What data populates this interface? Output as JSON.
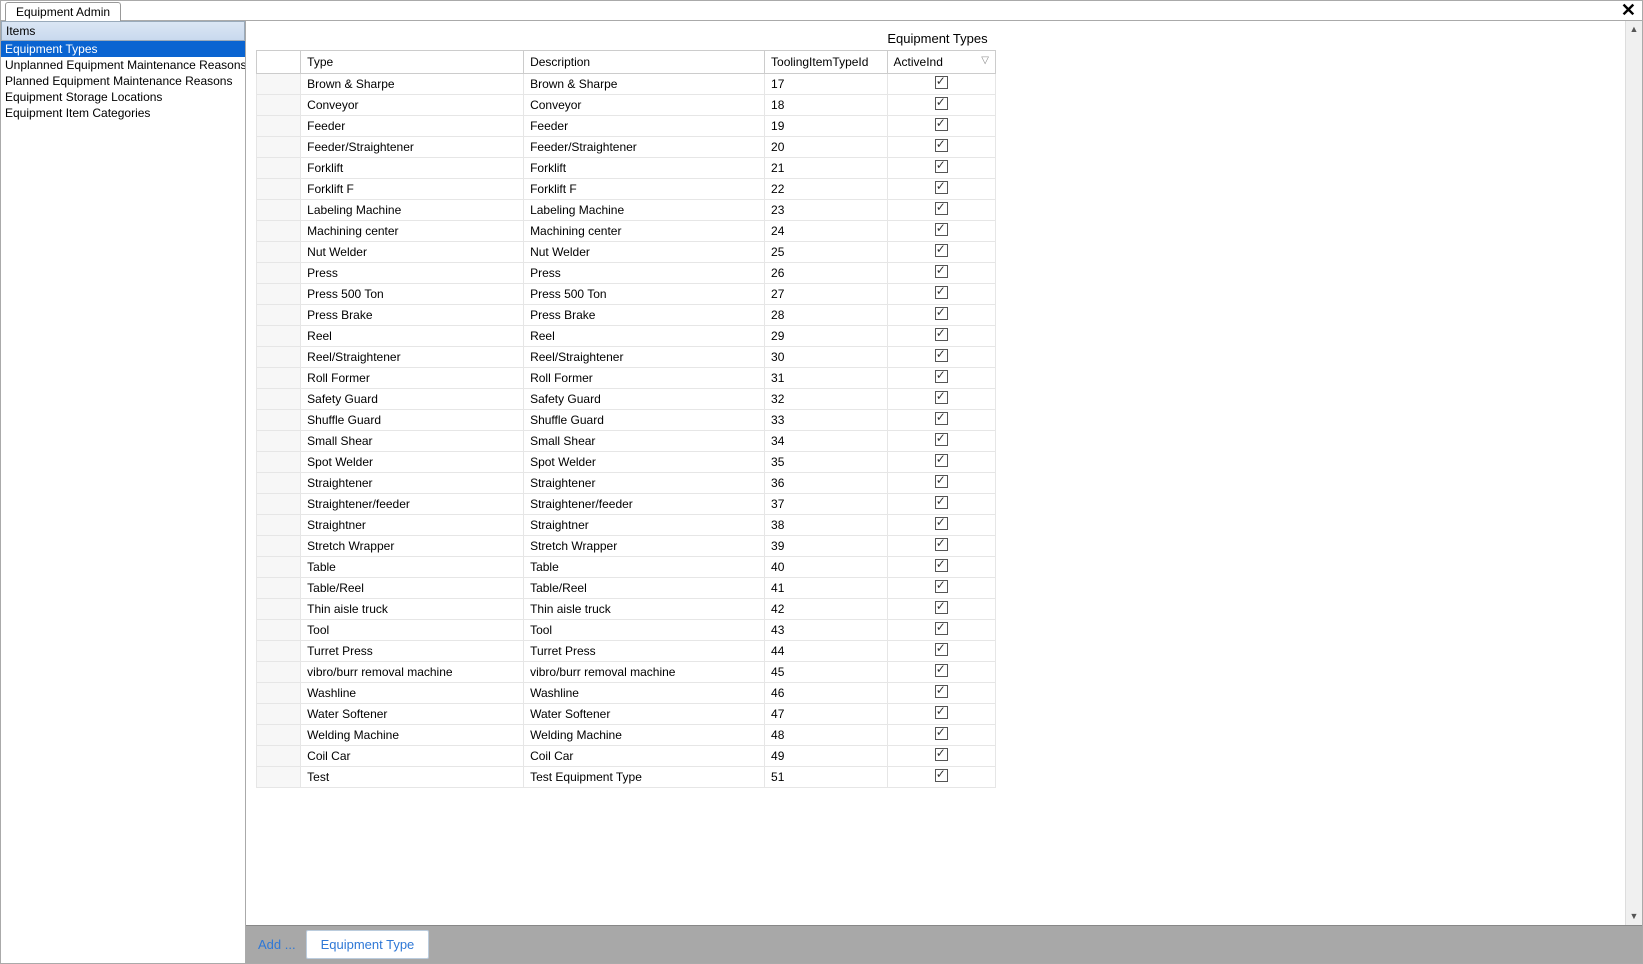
{
  "tab": {
    "label": "Equipment Admin"
  },
  "sidebar": {
    "header": "Items",
    "items": [
      {
        "label": "Equipment Types",
        "selected": true
      },
      {
        "label": "Unplanned Equipment Maintenance Reasons",
        "selected": false
      },
      {
        "label": "Planned Equipment Maintenance Reasons",
        "selected": false
      },
      {
        "label": "Equipment Storage Locations",
        "selected": false
      },
      {
        "label": "Equipment Item Categories",
        "selected": false
      }
    ]
  },
  "grid": {
    "title": "Equipment Types",
    "columns": {
      "type": "Type",
      "description": "Description",
      "toolingItemTypeId": "ToolingItemTypeId",
      "activeInd": "ActiveInd"
    },
    "rows": [
      {
        "type": "Brown & Sharpe",
        "description": "Brown & Sharpe",
        "id": "17",
        "active": true
      },
      {
        "type": "Conveyor",
        "description": "Conveyor",
        "id": "18",
        "active": true
      },
      {
        "type": "Feeder",
        "description": "Feeder",
        "id": "19",
        "active": true
      },
      {
        "type": "Feeder/Straightener",
        "description": "Feeder/Straightener",
        "id": "20",
        "active": true
      },
      {
        "type": "Forklift",
        "description": "Forklift",
        "id": "21",
        "active": true
      },
      {
        "type": "Forklift F",
        "description": "Forklift F",
        "id": "22",
        "active": true
      },
      {
        "type": "Labeling Machine",
        "description": "Labeling Machine",
        "id": "23",
        "active": true
      },
      {
        "type": "Machining center",
        "description": "Machining center",
        "id": "24",
        "active": true
      },
      {
        "type": "Nut Welder",
        "description": "Nut Welder",
        "id": "25",
        "active": true
      },
      {
        "type": "Press",
        "description": "Press",
        "id": "26",
        "active": true
      },
      {
        "type": "Press 500 Ton",
        "description": "Press 500 Ton",
        "id": "27",
        "active": true
      },
      {
        "type": "Press Brake",
        "description": "Press Brake",
        "id": "28",
        "active": true
      },
      {
        "type": "Reel",
        "description": "Reel",
        "id": "29",
        "active": true
      },
      {
        "type": "Reel/Straightener",
        "description": "Reel/Straightener",
        "id": "30",
        "active": true
      },
      {
        "type": "Roll Former",
        "description": "Roll Former",
        "id": "31",
        "active": true
      },
      {
        "type": "Safety Guard",
        "description": "Safety Guard",
        "id": "32",
        "active": true
      },
      {
        "type": "Shuffle Guard",
        "description": "Shuffle Guard",
        "id": "33",
        "active": true
      },
      {
        "type": "Small Shear",
        "description": "Small Shear",
        "id": "34",
        "active": true
      },
      {
        "type": "Spot Welder",
        "description": "Spot Welder",
        "id": "35",
        "active": true
      },
      {
        "type": "Straightener",
        "description": "Straightener",
        "id": "36",
        "active": true
      },
      {
        "type": "Straightener/feeder",
        "description": "Straightener/feeder",
        "id": "37",
        "active": true
      },
      {
        "type": "Straightner",
        "description": "Straightner",
        "id": "38",
        "active": true
      },
      {
        "type": "Stretch Wrapper",
        "description": "Stretch Wrapper",
        "id": "39",
        "active": true
      },
      {
        "type": "Table",
        "description": "Table",
        "id": "40",
        "active": true
      },
      {
        "type": "Table/Reel",
        "description": "Table/Reel",
        "id": "41",
        "active": true
      },
      {
        "type": "Thin aisle truck",
        "description": "Thin aisle truck",
        "id": "42",
        "active": true
      },
      {
        "type": "Tool",
        "description": "Tool",
        "id": "43",
        "active": true
      },
      {
        "type": "Turret Press",
        "description": "Turret Press",
        "id": "44",
        "active": true
      },
      {
        "type": "vibro/burr removal machine",
        "description": "vibro/burr removal machine",
        "id": "45",
        "active": true
      },
      {
        "type": "Washline",
        "description": "Washline",
        "id": "46",
        "active": true
      },
      {
        "type": "Water Softener",
        "description": "Water Softener",
        "id": "47",
        "active": true
      },
      {
        "type": "Welding Machine",
        "description": "Welding Machine",
        "id": "48",
        "active": true
      },
      {
        "type": "Coil Car",
        "description": "Coil Car",
        "id": "49",
        "active": true
      },
      {
        "type": "Test",
        "description": "Test Equipment Type",
        "id": "51",
        "active": true
      }
    ]
  },
  "footer": {
    "addLabel": "Add ...",
    "buttonLabel": "Equipment Type"
  }
}
